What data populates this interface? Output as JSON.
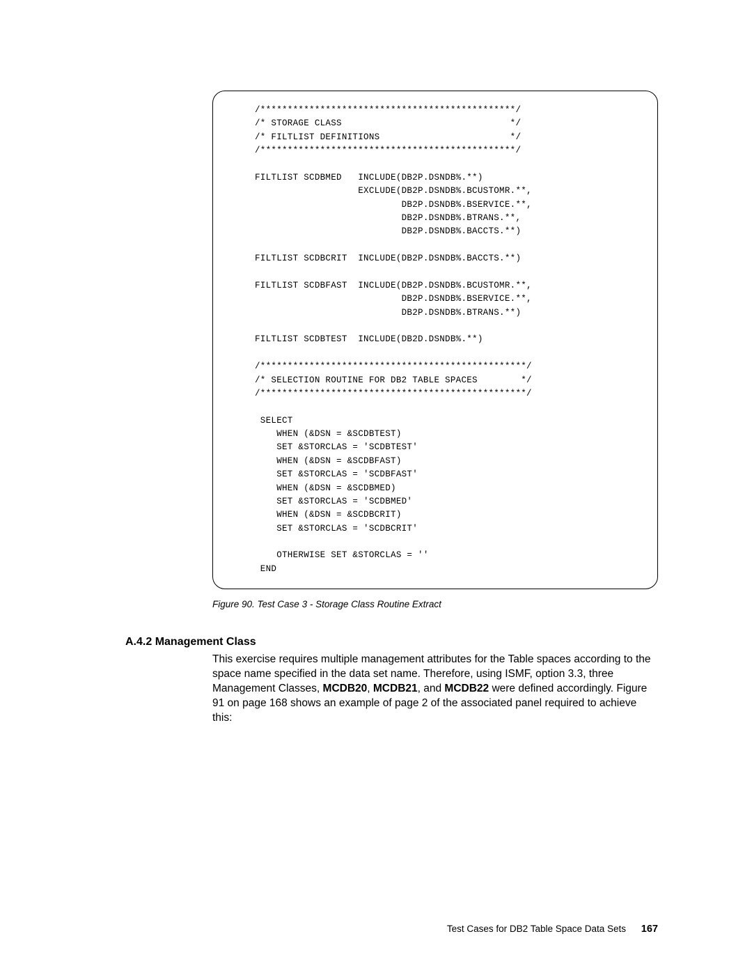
{
  "code": {
    "l01": "/***********************************************/",
    "l02": "/* STORAGE CLASS                               */",
    "l03": "/* FILTLIST DEFINITIONS                        */",
    "l04": "/***********************************************/",
    "l05": "",
    "l06": "FILTLIST SCDBMED   INCLUDE(DB2P.DSNDB%.**)",
    "l07": "                   EXCLUDE(DB2P.DSNDB%.BCUSTOMR.**,",
    "l08": "                           DB2P.DSNDB%.BSERVICE.**,",
    "l09": "                           DB2P.DSNDB%.BTRANS.**,",
    "l10": "                           DB2P.DSNDB%.BACCTS.**)",
    "l11": "",
    "l12": "FILTLIST SCDBCRIT  INCLUDE(DB2P.DSNDB%.BACCTS.**)",
    "l13": "",
    "l14": "FILTLIST SCDBFAST  INCLUDE(DB2P.DSNDB%.BCUSTOMR.**,",
    "l15": "                           DB2P.DSNDB%.BSERVICE.**,",
    "l16": "                           DB2P.DSNDB%.BTRANS.**)",
    "l17": "",
    "l18": "FILTLIST SCDBTEST  INCLUDE(DB2D.DSNDB%.**)",
    "l19": "",
    "l20": "/*************************************************/",
    "l21": "/* SELECTION ROUTINE FOR DB2 TABLE SPACES        */",
    "l22": "/*************************************************/",
    "l23": "",
    "l24": " SELECT",
    "l25": "    WHEN (&DSN = &SCDBTEST)",
    "l26": "    SET &STORCLAS = 'SCDBTEST'",
    "l27": "    WHEN (&DSN = &SCDBFAST)",
    "l28": "    SET &STORCLAS = 'SCDBFAST'",
    "l29": "    WHEN (&DSN = &SCDBMED)",
    "l30": "    SET &STORCLAS = 'SCDBMED'",
    "l31": "    WHEN (&DSN = &SCDBCRIT)",
    "l32": "    SET &STORCLAS = 'SCDBCRIT'",
    "l33": "",
    "l34": "    OTHERWISE SET &STORCLAS = ''",
    "l35": " END"
  },
  "figure_caption": "Figure 90.  Test Case 3 - Storage Class Routine Extract",
  "section_heading": "A.4.2  Management Class",
  "body": {
    "p1_a": "This exercise requires multiple management attributes for the Table spaces according to the space name specified in the data set name. Therefore, using ISMF, option 3.3, three Management Classes, ",
    "mc1": "MCDB20",
    "comma1": ", ",
    "mc2": "MCDB21",
    "and": ", and ",
    "mc3": "MCDB22",
    "p1_b": " were defined accordingly. Figure 91 on page 168 shows an example of page 2 of the associated panel required to achieve this:"
  },
  "footer": {
    "text": "Test Cases for DB2 Table Space Data Sets",
    "page": "167"
  }
}
